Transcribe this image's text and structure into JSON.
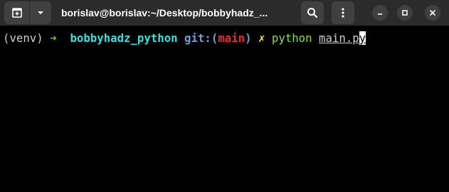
{
  "window": {
    "title": "borislav@borislav:~/Desktop/bobbyhadz_..."
  },
  "icons": {
    "new_tab": "new-tab-icon",
    "menu_caret": "chevron-down-icon",
    "search": "search-icon",
    "menu": "kebab-menu-icon",
    "minimize": "minimize-icon",
    "maximize": "maximize-icon",
    "close": "close-icon"
  },
  "terminal": {
    "venv": "(venv)",
    "arrow": "➜",
    "directory": "bobbyhadz_python",
    "git_label": "git:(",
    "branch": "main",
    "git_close": ")",
    "dirty_mark": "✗",
    "command": "python",
    "argument": "main.p",
    "cursor_char": "y"
  },
  "colors": {
    "background": "#000000",
    "titlebar": "#2b2b2b",
    "arrow": "#5fd700",
    "directory": "#34e2e2",
    "git": "#729fcf",
    "branch": "#ef2929",
    "dirty_mark": "#fce94f",
    "command": "#8ae234"
  }
}
